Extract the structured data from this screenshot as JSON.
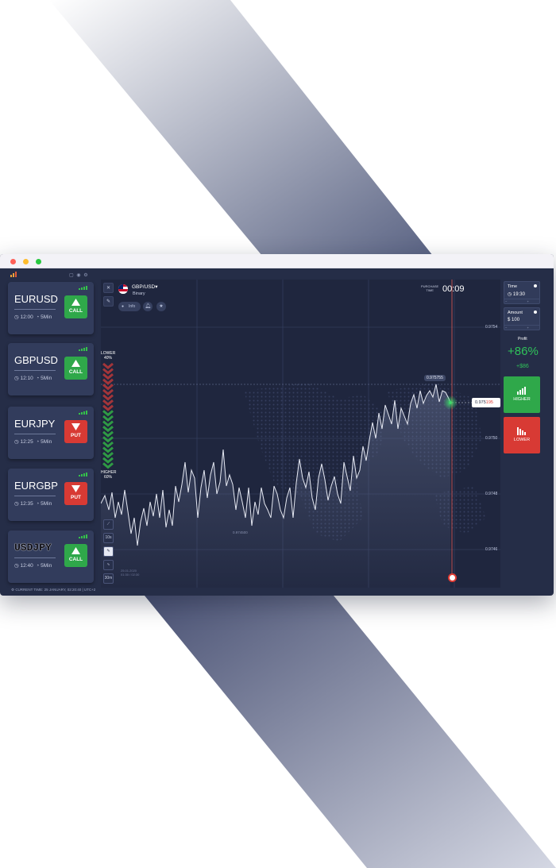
{
  "sidebar": {
    "pairs": [
      {
        "name": "EURUSD",
        "time": "12:00",
        "duration": "5Min",
        "action": "CALL"
      },
      {
        "name": "GBPUSD",
        "time": "12:10",
        "duration": "5Min",
        "action": "CALL"
      },
      {
        "name": "EURJPY",
        "time": "12:25",
        "duration": "5Min",
        "action": "PUT"
      },
      {
        "name": "EURGBP",
        "time": "12:35",
        "duration": "5Min",
        "action": "PUT"
      },
      {
        "name": "USDJPY",
        "time": "12:40",
        "duration": "5Min",
        "action": "CALL"
      }
    ]
  },
  "status_bar": {
    "text": "CURRENT TIME: 25 JANUARY, 02:20:40 | UTC+2"
  },
  "chart": {
    "pair": "GBP/USD▾",
    "type": "Binary",
    "info_pill": "Info",
    "purchase_label": "PURCHASE\nTIME",
    "purchase_time": "00:09",
    "peak_price": "0.975755",
    "current_price_main": "0.975",
    "current_price_tail": "195",
    "price_levels": [
      "0.9754",
      "0.9750",
      "0.9748",
      "0.9746"
    ],
    "mid_label": "0.974500",
    "bottom_label": "25.01.2020\n01:30 / 02:30",
    "sentiment": {
      "lower_label": "LOWER",
      "lower_pct": "40%",
      "higher_label": "HIGHER",
      "higher_pct": "60%"
    },
    "tools": [
      "10s",
      "30m"
    ]
  },
  "right_panel": {
    "time": {
      "label": "Time",
      "value": "19:30"
    },
    "amount": {
      "label": "Amount",
      "currency": "$",
      "value": "100"
    },
    "profit_label": "Profit",
    "profit_pct": "+86%",
    "profit_amount": "+$86",
    "higher_label": "HIGHER",
    "lower_label": "LOWER"
  },
  "colors": {
    "window_bg": "#252d47",
    "card_bg": "#323c5c",
    "call_green": "#2fa84a",
    "put_red": "#d83a34",
    "profit_green": "#2fc25a"
  },
  "icons": [
    "logo-icon",
    "clock-icon",
    "timer-icon",
    "signal-icon",
    "arrow-up-icon",
    "arrow-down-icon",
    "flag-icon",
    "bell-icon",
    "star-icon",
    "close-icon",
    "pencil-icon",
    "settings-icon",
    "info-icon"
  ]
}
